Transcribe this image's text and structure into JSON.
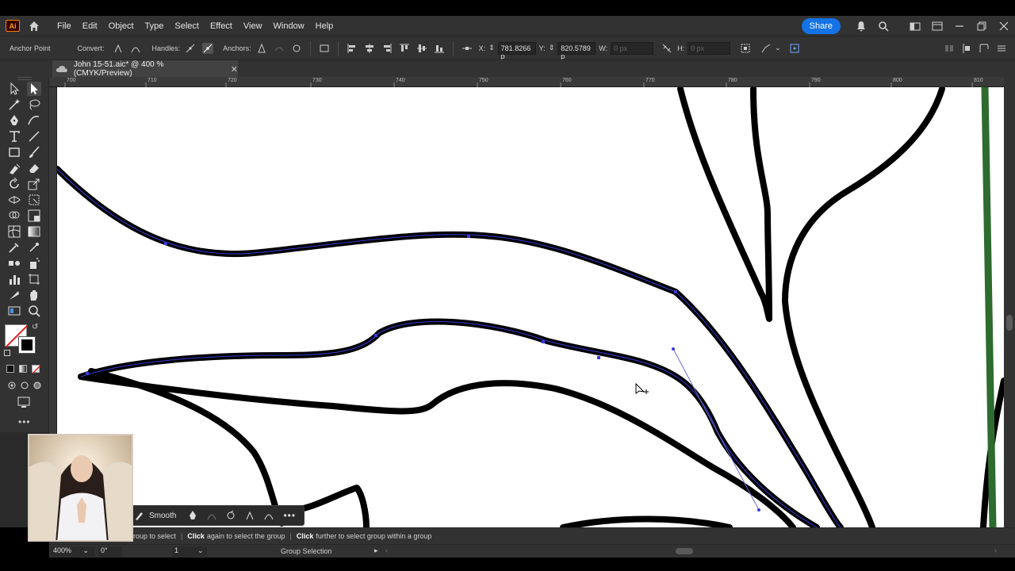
{
  "menubar": {
    "app_logo": "Ai",
    "items": [
      "File",
      "Edit",
      "Object",
      "Type",
      "Select",
      "Effect",
      "View",
      "Window",
      "Help"
    ],
    "share_label": "Share"
  },
  "controlbar": {
    "tool_name": "Anchor Point",
    "convert_label": "Convert:",
    "handles_label": "Handles:",
    "anchors_label": "Anchors:",
    "x_label": "X:",
    "x_value": "781.8266 p",
    "y_label": "Y:",
    "y_value": "820.5789 p",
    "w_label": "W:",
    "w_value": "0 px",
    "h_label": "H:",
    "h_value": "0 px"
  },
  "document_tab": {
    "title": "John 15-51.aic* @ 400 % (CMYK/Preview)",
    "close": "✕"
  },
  "ruler": {
    "labels": [
      "700",
      "710",
      "720",
      "730",
      "740",
      "750",
      "760",
      "770",
      "780",
      "790",
      "800",
      "810"
    ]
  },
  "statusbar": {
    "partial_text": "roup to select",
    "click_again": "Click",
    "again_text": "again to select the group",
    "click_further": "Click",
    "further_text": "further to select group within a group"
  },
  "bottombar": {
    "zoom": "400%",
    "rotation": "0°",
    "artboard": "1",
    "tool_status": "Group Selection"
  },
  "context_bar": {
    "smooth_label": "Smooth"
  },
  "colors": {
    "accent": "#1473e6",
    "green_line": "#2e6b2e",
    "path_outline": "#3b3bd6",
    "panel": "#323232"
  }
}
